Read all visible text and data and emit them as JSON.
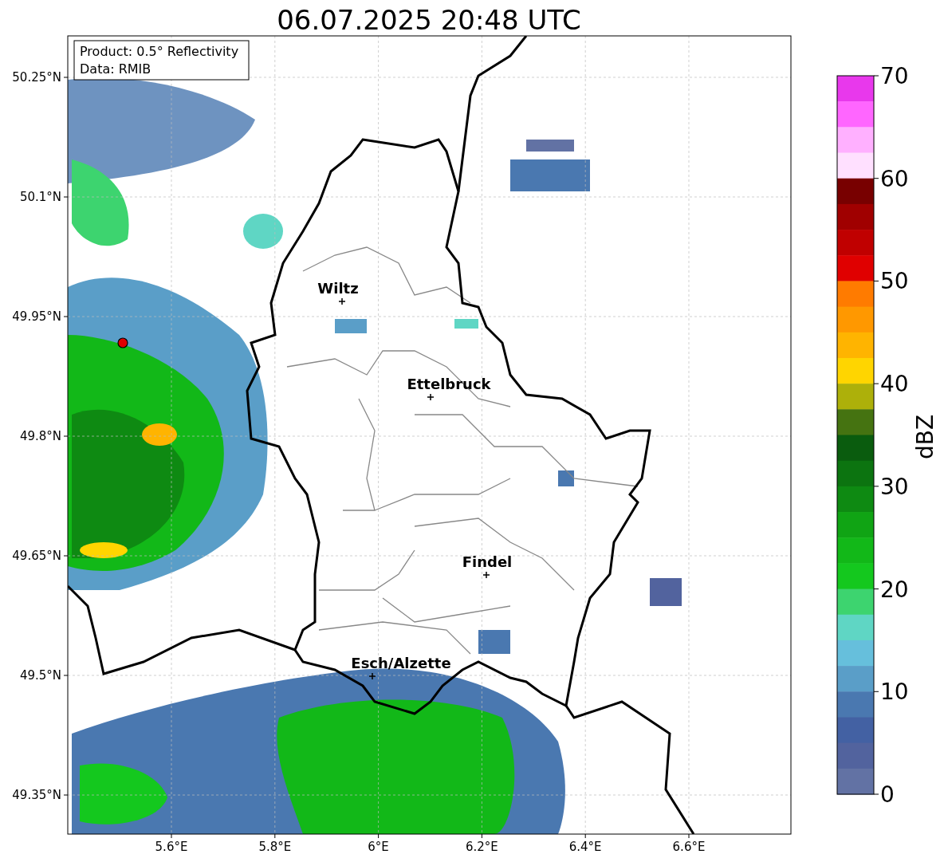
{
  "title": "06.07.2025 20:48 UTC",
  "info_box": {
    "lines": [
      "Product: 0.5° Reflectivity",
      "Data: RMIB"
    ]
  },
  "y_ticks": [
    "50.25°N",
    "50.1°N",
    "49.95°N",
    "49.8°N",
    "49.65°N",
    "49.5°N",
    "49.35°N"
  ],
  "x_ticks": [
    "5.6°E",
    "5.8°E",
    "6°E",
    "6.2°E",
    "6.4°E",
    "6.6°E"
  ],
  "cities": [
    {
      "name": "Wiltz"
    },
    {
      "name": "Ettelbruck"
    },
    {
      "name": "Findel"
    },
    {
      "name": "Esch/Alzette"
    }
  ],
  "colorbar": {
    "label": "dBZ",
    "ticks": [
      "70",
      "60",
      "50",
      "40",
      "30",
      "20",
      "10",
      "0"
    ],
    "bins": [
      {
        "color": "#e838ec"
      },
      {
        "color": "#ff66ff"
      },
      {
        "color": "#ffb0ff"
      },
      {
        "color": "#ffe0ff"
      },
      {
        "color": "#780000"
      },
      {
        "color": "#a00000"
      },
      {
        "color": "#c00000"
      },
      {
        "color": "#e00000"
      },
      {
        "color": "#ff7b00"
      },
      {
        "color": "#ff9800"
      },
      {
        "color": "#ffb400"
      },
      {
        "color": "#ffd500"
      },
      {
        "color": "#adb00a"
      },
      {
        "color": "#457311"
      },
      {
        "color": "#0a5c0e"
      },
      {
        "color": "#0c7410"
      },
      {
        "color": "#0e8a12"
      },
      {
        "color": "#10a414"
      },
      {
        "color": "#12b818"
      },
      {
        "color": "#14c81e"
      },
      {
        "color": "#3dd46f"
      },
      {
        "color": "#5fd6c4"
      },
      {
        "color": "#66bfdc"
      },
      {
        "color": "#5a9ec8"
      },
      {
        "color": "#4a78b0"
      },
      {
        "color": "#4361a3"
      },
      {
        "color": "#52639e"
      },
      {
        "color": "#6272a4"
      }
    ]
  }
}
